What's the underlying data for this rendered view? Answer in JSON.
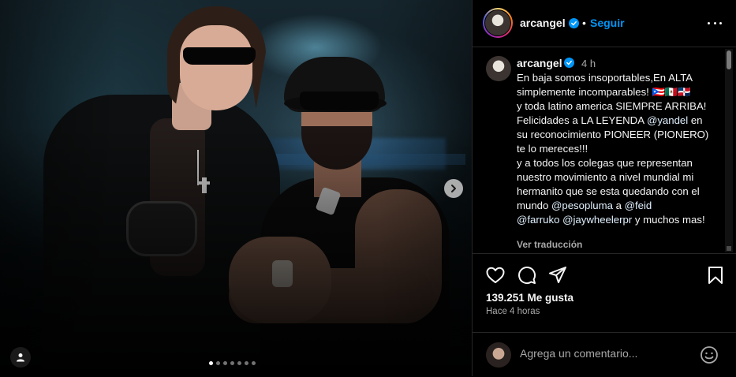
{
  "media": {
    "next_icon": "chevron-right-icon",
    "tag_icon": "user-tag-icon",
    "carousel": {
      "count": 7,
      "active_index": 0
    }
  },
  "header": {
    "username": "arcangel",
    "verified_icon": "verified-badge-icon",
    "separator": "•",
    "follow_label": "Seguir",
    "more_icon": "more-options-icon"
  },
  "caption": {
    "username": "arcangel",
    "time": "4 h",
    "text_before": "En baja somos insoportables,En ALTA simplemente incomparables! 🇵🇷🇲🇽🇩🇴\ny toda latino america SIEMPRE ARRIBA! Felicidades a LA LEYENDA ",
    "mention1": "@yandel",
    "text_middle": " en su reconocimiento PIONEER (PIONERO) te lo mereces!!!\ny a todos los colegas que representan nuestro movimiento a nivel mundial mi hermanito que se esta quedando con el mundo ",
    "mention2": "@pesopluma",
    "text_a": " a ",
    "mention3": "@feid",
    "text_b": "\n",
    "mention4": "@farruko",
    "text_c": " ",
    "mention5": "@jaywheelerpr",
    "text_end": " y muchos mas!",
    "translate_label": "Ver traducción"
  },
  "actions": {
    "like_icon": "heart-icon",
    "comment_icon": "comment-icon",
    "share_icon": "share-icon",
    "save_icon": "bookmark-icon"
  },
  "stats": {
    "likes": "139.251 Me gusta",
    "posted": "Hace 4 horas"
  },
  "comment": {
    "placeholder": "Agrega un comentario...",
    "emoji_icon": "emoji-icon"
  },
  "colors": {
    "accent": "#0095f6",
    "background": "#000000",
    "secondary_text": "#a8a8a8"
  }
}
